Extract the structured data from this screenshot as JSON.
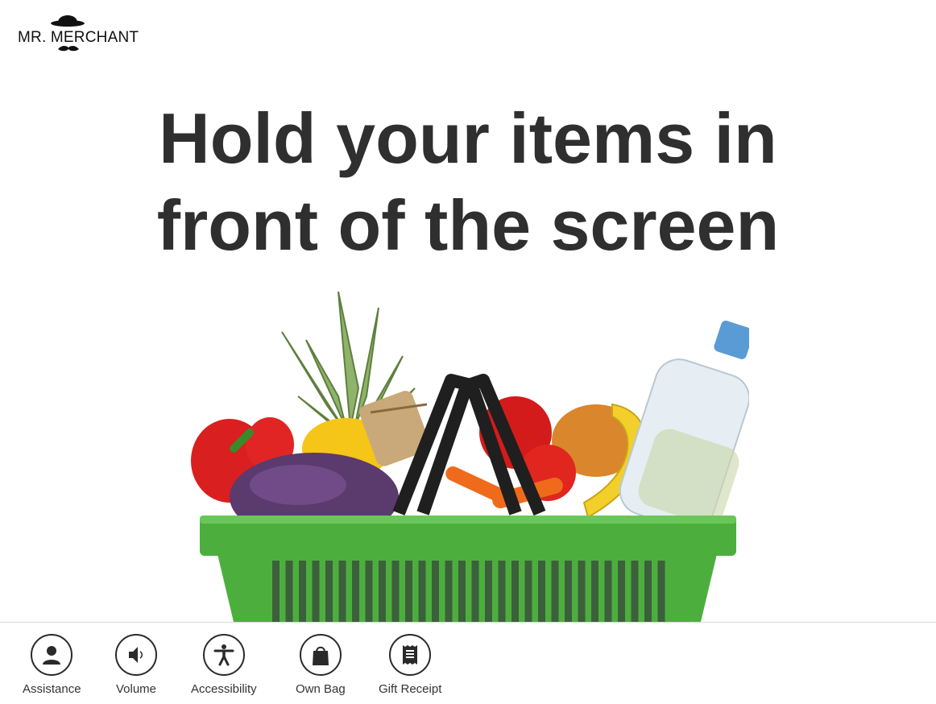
{
  "brand": {
    "name": "MR. MERCHANT",
    "logo_icons": [
      "bowler-hat-icon",
      "mustache-icon"
    ]
  },
  "headline": {
    "line1": "Hold your items in",
    "line2": "front of the screen"
  },
  "illustration": {
    "description_icon": "grocery-basket-illustration"
  },
  "toolbar": {
    "items": [
      {
        "label": "Assistance",
        "icon": "person-icon"
      },
      {
        "label": "Volume",
        "icon": "speaker-icon"
      },
      {
        "label": "Accessibility",
        "icon": "accessibility-icon"
      },
      {
        "label": "Own Bag",
        "icon": "bag-icon"
      },
      {
        "label": "Gift Receipt",
        "icon": "receipt-icon"
      }
    ]
  },
  "colors": {
    "headline": "#2f2f2f",
    "basket_green": "#4caf3d",
    "icon_stroke": "#2a2a2a"
  }
}
